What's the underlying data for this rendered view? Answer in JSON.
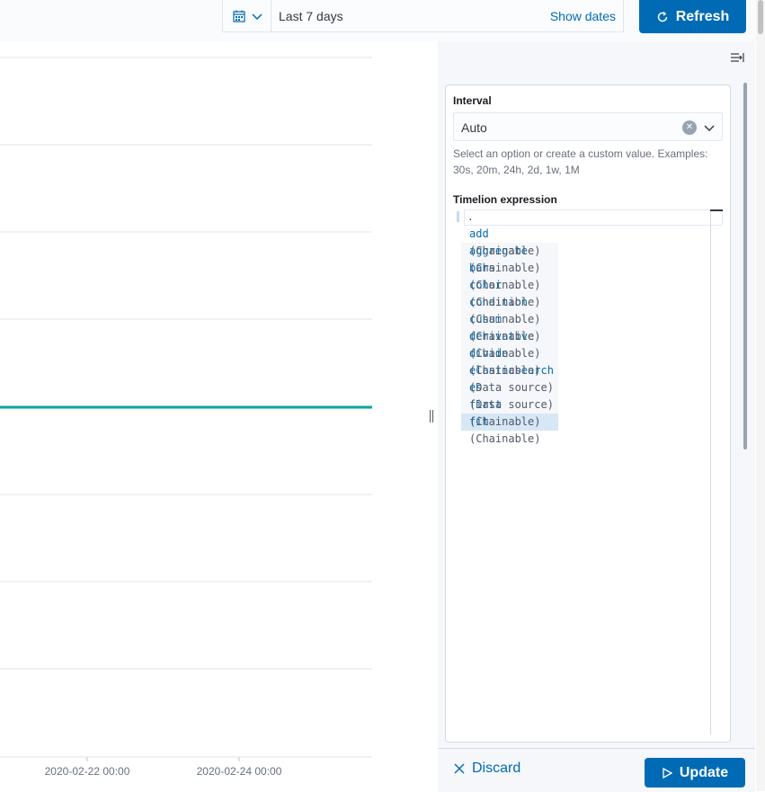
{
  "topbar": {
    "quick_select_icon": "calendar-icon",
    "date_range": "Last 7 days",
    "show_dates_label": "Show dates",
    "refresh_label": "Refresh",
    "refresh_icon": "refresh-icon"
  },
  "chart": {
    "x_ticks": [
      "2020-02-22 00:00",
      "2020-02-24 00:00"
    ],
    "series_color": "#00a69b"
  },
  "panel": {
    "collapse_icon": "collapse-panel-icon",
    "interval": {
      "label": "Interval",
      "value": "Auto",
      "help": "Select an option or create a custom value. Examples: 30s, 20m, 24h, 2d, 1w, 1M"
    },
    "expression": {
      "label": "Timelion expression",
      "value": "."
    },
    "suggestions": [
      {
        "name": "add",
        "desc": ""
      },
      {
        "name": "aggregate",
        "desc": "(Chainable)"
      },
      {
        "name": "bars",
        "desc": "(Chainable)"
      },
      {
        "name": "color",
        "desc": "(Chainable)"
      },
      {
        "name": "condition",
        "desc": "(Chainable)"
      },
      {
        "name": "cusum",
        "desc": "(Chainable)"
      },
      {
        "name": "derivative",
        "desc": "(Chainable)"
      },
      {
        "name": "divide",
        "desc": "(Chainable)"
      },
      {
        "name": "elasticsearch",
        "desc": "(Chainable)"
      },
      {
        "name": "es",
        "desc": "(Data source)"
      },
      {
        "name": "first",
        "desc": "(Data source)"
      },
      {
        "name": "fit",
        "desc": "(Chainable)"
      },
      {
        "name": "",
        "desc": "(Chainable)"
      }
    ],
    "discard_label": "Discard",
    "update_label": "Update"
  },
  "colors": {
    "primary": "#006bb4",
    "series": "#00a69b"
  }
}
